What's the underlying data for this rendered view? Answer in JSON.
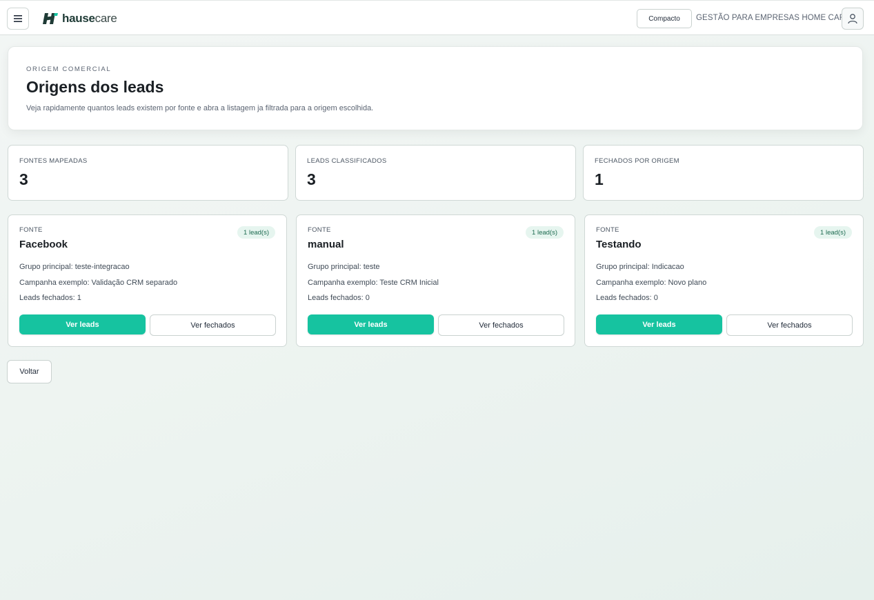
{
  "header": {
    "logo_bold": "hause",
    "logo_light": "care",
    "compact_label": "Compacto",
    "company_name": "GESTÃO PARA EMPRESAS HOME CARE",
    "icons": {
      "menu": "menu-icon",
      "user": "user-icon",
      "logo": "hausecare-logo-mark"
    }
  },
  "hero": {
    "eyebrow": "ORIGEM COMERCIAL",
    "title": "Origens dos leads",
    "description": "Veja rapidamente quantos leads existem por fonte e abra a listagem ja filtrada para a origem escolhida."
  },
  "stats": [
    {
      "label": "FONTES MAPEADAS",
      "value": "3"
    },
    {
      "label": "LEADS CLASSIFICADOS",
      "value": "3"
    },
    {
      "label": "FECHADOS POR ORIGEM",
      "value": "1"
    }
  ],
  "sources": [
    {
      "label": "FONTE",
      "name": "Facebook",
      "badge": "1 lead(s)",
      "group": "Grupo principal: teste-integracao",
      "campaign": "Campanha exemplo: Validação CRM separado",
      "closed": "Leads fechados: 1",
      "primary_label": "Ver leads",
      "secondary_label": "Ver fechados"
    },
    {
      "label": "FONTE",
      "name": "manual",
      "badge": "1 lead(s)",
      "group": "Grupo principal: teste",
      "campaign": "Campanha exemplo: Teste CRM Inicial",
      "closed": "Leads fechados: 0",
      "primary_label": "Ver leads",
      "secondary_label": "Ver fechados"
    },
    {
      "label": "FONTE",
      "name": "Testando",
      "badge": "1 lead(s)",
      "group": "Grupo principal: Indicacao",
      "campaign": "Campanha exemplo: Novo plano",
      "closed": "Leads fechados: 0",
      "primary_label": "Ver leads",
      "secondary_label": "Ver fechados"
    }
  ],
  "back_label": "Voltar",
  "colors": {
    "accent": "#16c3a0",
    "badge_bg": "#e6f5ef",
    "badge_text": "#1d6b50",
    "logo_dark": "#1f3b36"
  }
}
